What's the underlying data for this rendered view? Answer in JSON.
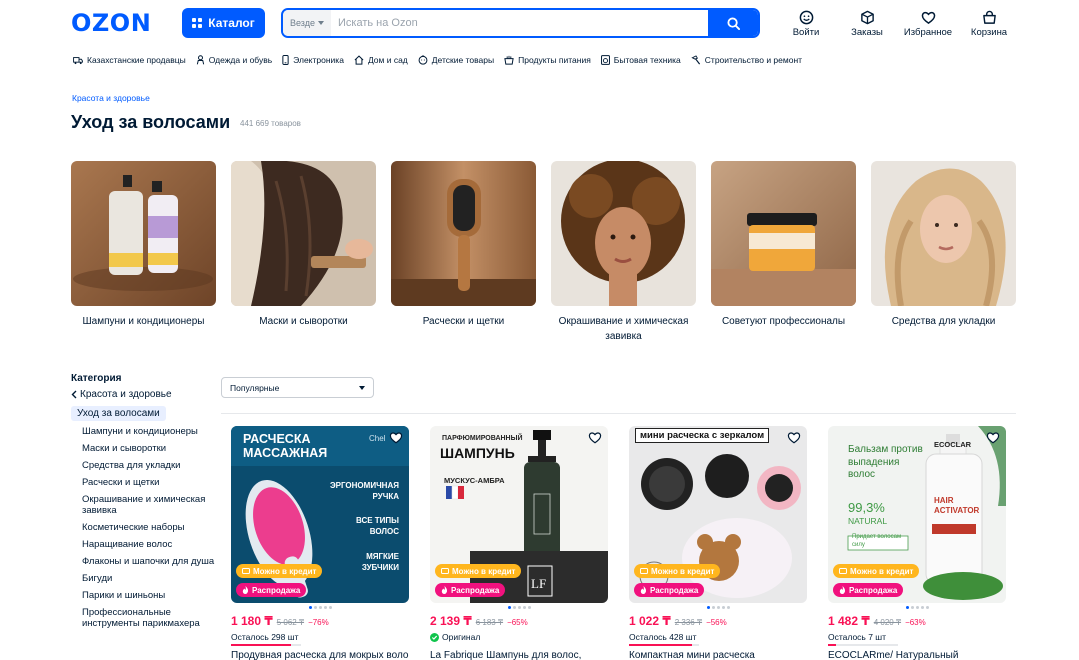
{
  "header": {
    "logo": "OZON",
    "catalog_label": "Каталог",
    "search_scope": "Везде",
    "search_placeholder": "Искать на Ozon",
    "actions": [
      {
        "label": "Войти",
        "icon": "smile-icon"
      },
      {
        "label": "Заказы",
        "icon": "box-icon"
      },
      {
        "label": "Избранное",
        "icon": "heart-icon"
      },
      {
        "label": "Корзина",
        "icon": "cart-icon"
      }
    ]
  },
  "topnav": [
    {
      "label": "Казахстанские продавцы",
      "icon": "truck-icon"
    },
    {
      "label": "Одежда и обувь",
      "icon": "clothes-icon"
    },
    {
      "label": "Электроника",
      "icon": "phone-icon"
    },
    {
      "label": "Дом и сад",
      "icon": "home-icon"
    },
    {
      "label": "Детские товары",
      "icon": "baby-icon"
    },
    {
      "label": "Продукты питания",
      "icon": "food-icon"
    },
    {
      "label": "Бытовая техника",
      "icon": "appliance-icon"
    },
    {
      "label": "Строительство и ремонт",
      "icon": "hammer-icon"
    }
  ],
  "breadcrumb": "Красота и здоровье",
  "page": {
    "title": "Уход за волосами",
    "count": "441 669 товаров"
  },
  "tiles": [
    {
      "label": "Шампуни и кондиционеры"
    },
    {
      "label": "Маски и сыворотки"
    },
    {
      "label": "Расчески и щетки"
    },
    {
      "label": "Окрашивание и химическая завивка"
    },
    {
      "label": "Советуют профессионалы"
    },
    {
      "label": "Средства для укладки"
    }
  ],
  "sidebar": {
    "title": "Категория",
    "parent": "Красота и здоровье",
    "current": "Уход за волосами",
    "items": [
      "Шампуни и кондиционеры",
      "Маски и сыворотки",
      "Средства для укладки",
      "Расчески и щетки",
      "Окрашивание и химическая завивка",
      "Косметические наборы",
      "Наращивание волос",
      "Флаконы и шапочки для душа",
      "Бигуди",
      "Парики и шиньоны",
      "Профессиональные инструменты парикмахера"
    ]
  },
  "sort": {
    "selected": "Популярные"
  },
  "badges": {
    "credit": "Можно в кредит",
    "sale": "Распродажа"
  },
  "products": [
    {
      "promo_title": "РАСЧЕСКА МАССАЖНАЯ",
      "promo_brand": "Chel",
      "promo_features": [
        "ЭРГОНОМИЧНАЯ РУЧКА",
        "ВСЕ ТИПЫ ВОЛОС",
        "МЯГКИЕ ЗУБЧИКИ"
      ],
      "price": "1 180 ₸",
      "old_price": "5 062 ₸",
      "discount": "−76%",
      "stock": "Осталось 298 шт",
      "stock_level": 0.85,
      "name": "Продувная расческа для мокрых волос"
    },
    {
      "promo_title": "ПАРФЮМИРОВАННЫЙ",
      "promo_subtitle": "ШАМПУНЬ",
      "promo_scent": "МУСКУС-АМБРА",
      "promo_logo": "LF",
      "price": "2 139 ₸",
      "old_price": "6 183 ₸",
      "discount": "−65%",
      "stock": "Оригинал",
      "name": "La Fabrique Шампунь для волос,"
    },
    {
      "promo_title": "мини расческа с зеркалом",
      "price": "1 022 ₸",
      "old_price": "2 336 ₸",
      "discount": "−56%",
      "stock": "Осталось 428 шт",
      "stock_level": 0.9,
      "name": "Компактная мини расческа"
    },
    {
      "promo_title": "Бальзам против выпадения волос",
      "promo_percent": "99,3%",
      "promo_natural": "NATURAL",
      "promo_note": "Придает волосам силу",
      "promo_brand": "ECOCLAR",
      "promo_product": "HAIR ACTIVATOR",
      "price": "1 482 ₸",
      "old_price": "4 020 ₸",
      "discount": "−63%",
      "stock": "Осталось 7 шт",
      "stock_level": 0.12,
      "name": "ECOCLARme/ Натуральный"
    }
  ],
  "colors": {
    "brand": "#005bff",
    "price": "#f91155",
    "credit": "#ffb61e",
    "sale": "#f1117e"
  }
}
